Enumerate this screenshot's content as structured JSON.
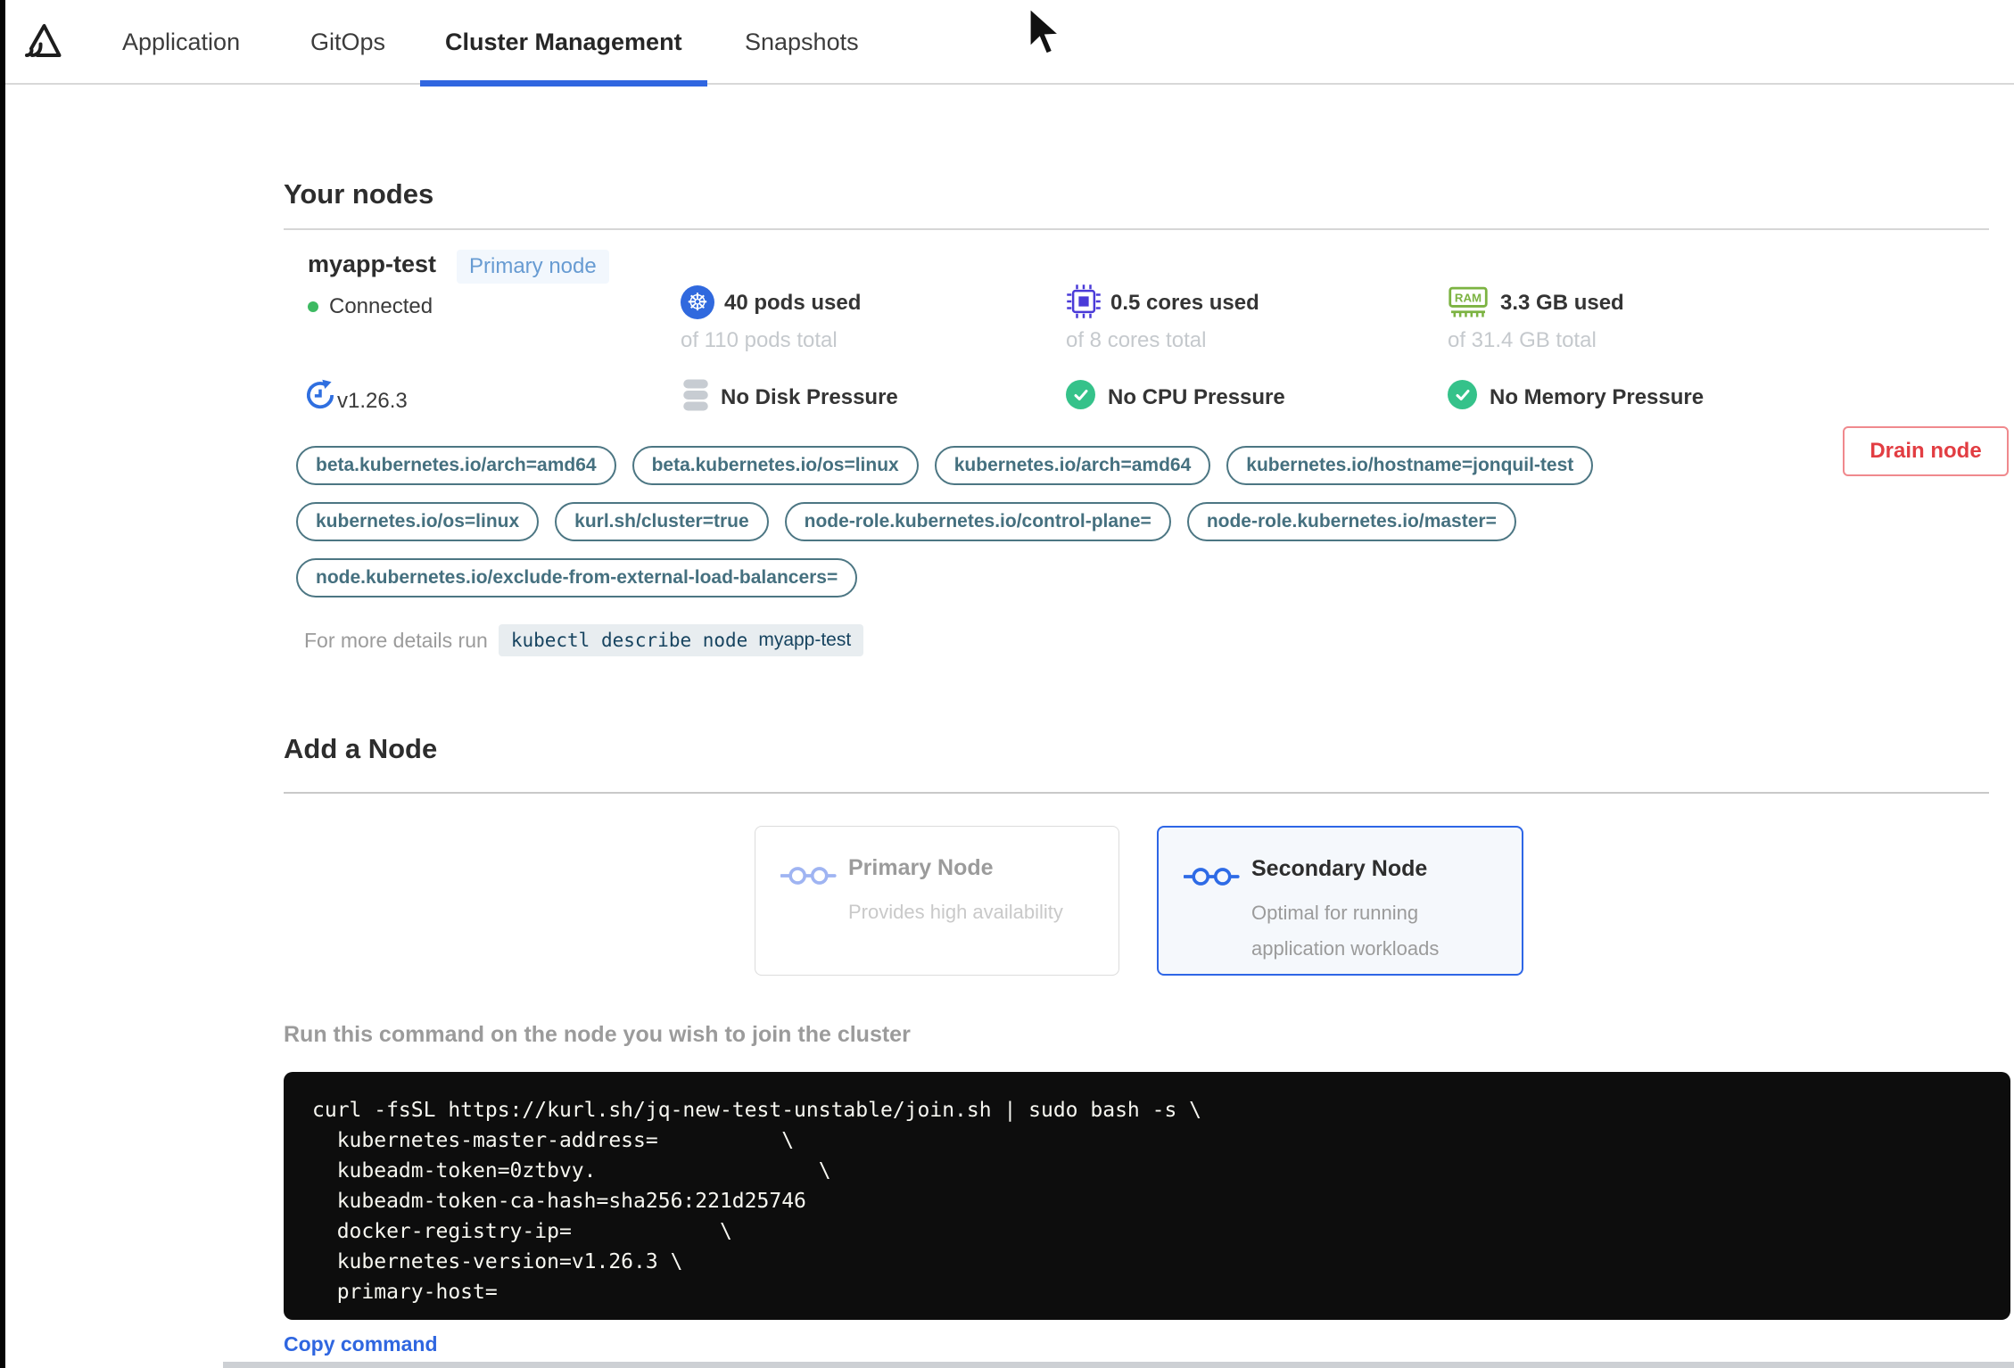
{
  "nav": {
    "tabs": [
      {
        "label": "Application",
        "active": false
      },
      {
        "label": "GitOps",
        "active": false
      },
      {
        "label": "Cluster Management",
        "active": true
      },
      {
        "label": "Snapshots",
        "active": false
      }
    ]
  },
  "your_nodes": {
    "title": "Your nodes",
    "node": {
      "name": "myapp-test",
      "badge": "Primary node",
      "status": "Connected",
      "version": "v1.26.3",
      "pods_used": "40 pods used",
      "pods_total": "of 110 pods total",
      "cores_used": "0.5 cores used",
      "cores_total": "of 8 cores total",
      "memory_used": "3.3 GB used",
      "memory_total": "of 31.4 GB total",
      "disk_pressure": "No Disk Pressure",
      "cpu_pressure": "No CPU Pressure",
      "memory_pressure": "No Memory Pressure",
      "drain_label": "Drain node",
      "labels": [
        "beta.kubernetes.io/arch=amd64",
        "beta.kubernetes.io/os=linux",
        "kubernetes.io/arch=amd64",
        "kubernetes.io/hostname=jonquil-test",
        "kubernetes.io/os=linux",
        "kurl.sh/cluster=true",
        "node-role.kubernetes.io/control-plane=",
        "node-role.kubernetes.io/master=",
        "node.kubernetes.io/exclude-from-external-load-balancers="
      ],
      "details_prefix": "For more details run",
      "details_command": "kubectl describe node",
      "details_node": "myapp-test"
    }
  },
  "add_node": {
    "title": "Add a Node",
    "options": [
      {
        "title": "Primary Node",
        "description": "Provides high availability",
        "selected": false
      },
      {
        "title": "Secondary Node",
        "description": "Optimal for running application workloads",
        "selected": true
      }
    ],
    "command_label": "Run this command on the node you wish to join the cluster",
    "join_command": "curl -fsSL https://kurl.sh/jq-new-test-unstable/join.sh | sudo bash -s \\\n  kubernetes-master-address=          \\\n  kubeadm-token=0ztbvy.                  \\\n  kubeadm-token-ca-hash=sha256:221d25746\n  docker-registry-ip=            \\\n  kubernetes-version=v1.26.3 \\\n  primary-host=",
    "copy_label": "Copy command"
  },
  "colors": {
    "accent_blue": "#3066e0",
    "drain_red": "#e23d42",
    "pill_teal": "#45707f",
    "success_green": "#35c28a",
    "k8s_blue": "#3069de",
    "cpu_purple": "#4a3bd8",
    "ram_green": "#7cb342",
    "connected_green": "#3dba62"
  }
}
